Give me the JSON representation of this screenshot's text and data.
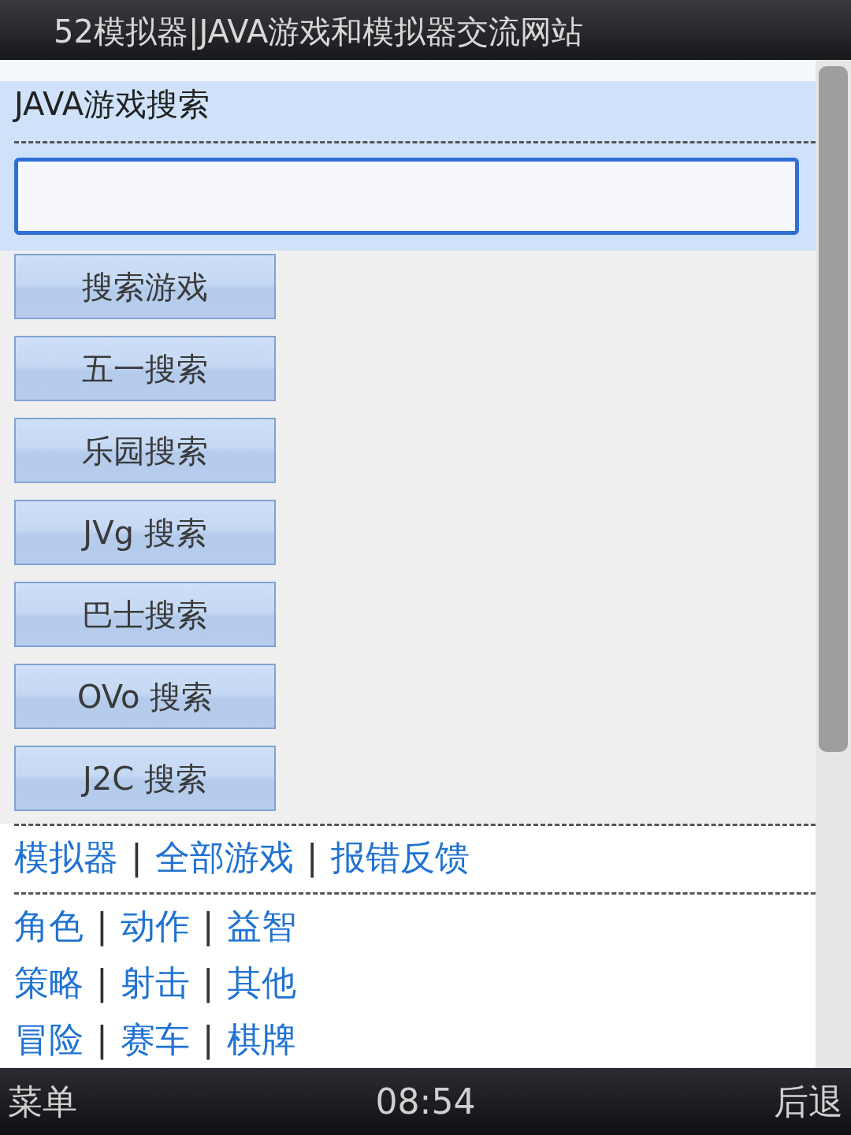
{
  "window": {
    "title": "52模拟器|JAVA游戏和模拟器交流网站"
  },
  "section_title": "JAVA游戏搜索",
  "buttons": [
    "搜索游戏",
    "五一搜索",
    "乐园搜索",
    "JVg 搜索",
    "巴士搜索",
    "OVo 搜索",
    "J2C 搜索"
  ],
  "links": [
    {
      "kind": "link",
      "text": "模拟器"
    },
    {
      "kind": "separator",
      "text": "|"
    },
    {
      "kind": "link",
      "text": "全部游戏"
    },
    {
      "kind": "separator",
      "text": "|"
    },
    {
      "kind": "link",
      "text": "报错反馈"
    }
  ],
  "categories": [
    [
      {
        "kind": "link",
        "text": "角色"
      },
      {
        "kind": "separator",
        "text": "|"
      },
      {
        "kind": "link",
        "text": "动作"
      },
      {
        "kind": "separator",
        "text": "|"
      },
      {
        "kind": "link",
        "text": "益智"
      }
    ],
    [
      {
        "kind": "link",
        "text": "策略"
      },
      {
        "kind": "separator",
        "text": "|"
      },
      {
        "kind": "link",
        "text": "射击"
      },
      {
        "kind": "separator",
        "text": "|"
      },
      {
        "kind": "link",
        "text": "其他"
      }
    ],
    [
      {
        "kind": "link",
        "text": "冒险"
      },
      {
        "kind": "separator",
        "text": "|"
      },
      {
        "kind": "link",
        "text": "赛车"
      },
      {
        "kind": "separator",
        "text": "|"
      },
      {
        "kind": "link",
        "text": "棋牌"
      }
    ]
  ],
  "softkeys": {
    "left": "菜单",
    "clock": "08:54",
    "right": "后退"
  }
}
